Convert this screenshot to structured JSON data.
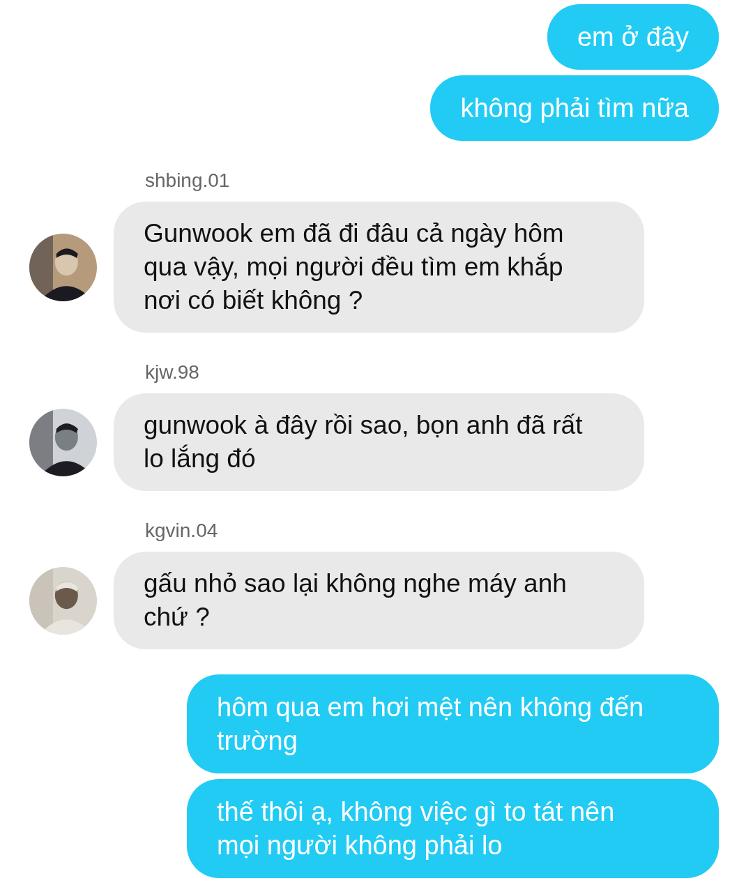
{
  "messages": [
    {
      "kind": "outgoing",
      "text": "em ở đây"
    },
    {
      "kind": "outgoing",
      "text": "không phải tìm nữa"
    },
    {
      "kind": "incoming",
      "sender": "shbing.01",
      "text": "Gunwook em đã đi đâu cả ngày hôm\nqua vậy, mọi người đều tìm em khắp\nnơi có biết không ?"
    },
    {
      "kind": "incoming",
      "sender": "kjw.98",
      "text": "gunwook à đây rồi sao, bọn anh đã rất\nlo lắng đó"
    },
    {
      "kind": "incoming",
      "sender": "kgvin.04",
      "text": "gấu nhỏ sao lại không nghe máy anh\nchứ ?"
    },
    {
      "kind": "outgoing",
      "text": "hôm qua em hơi mệt nên không đến\ntrường"
    },
    {
      "kind": "outgoing",
      "text": "thế thôi ạ, không việc gì to tát nên\nmọi người không phải lo"
    }
  ]
}
